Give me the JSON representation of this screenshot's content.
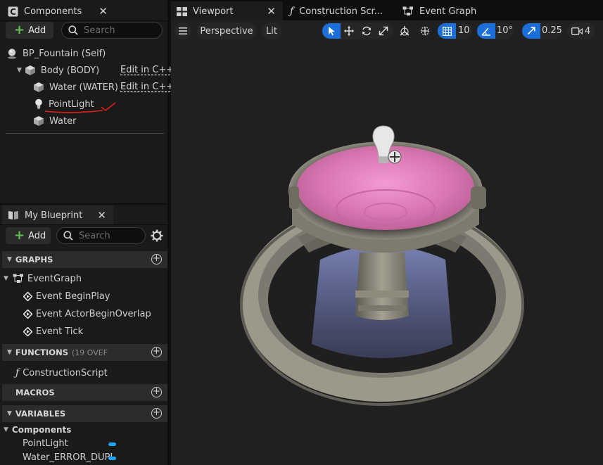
{
  "components_panel": {
    "tab_title": "Components",
    "add_label": "Add",
    "search_placeholder": "Search",
    "tree": {
      "root": "BP_Fountain (Self)",
      "body": "Body (BODY)",
      "water_child": "Water (WATER)",
      "pointlight": "PointLight",
      "water": "Water",
      "edit_cpp": "Edit in C++"
    }
  },
  "blueprint_panel": {
    "tab_title": "My Blueprint",
    "add_label": "Add",
    "search_placeholder": "Search",
    "graphs_header": "GRAPHS",
    "event_graph": "EventGraph",
    "events": [
      "Event BeginPlay",
      "Event ActorBeginOverlap",
      "Event Tick"
    ],
    "functions_header": "FUNCTIONS",
    "functions_note": "(19 OVEF",
    "construction_script": "ConstructionScript",
    "macros_header": "MACROS",
    "variables_header": "VARIABLES",
    "components_category": "Components",
    "variables": [
      "PointLight",
      "Water_ERROR_DUPL"
    ],
    "variable_color": "#1aa3ff"
  },
  "editor_tabs": {
    "viewport": "Viewport",
    "construction": "Construction Scr...",
    "event_graph": "Event Graph"
  },
  "viewport_toolbar": {
    "perspective": "Perspective",
    "lit": "Lit",
    "grid_snap": "10",
    "rotation_snap": "10°",
    "scale_snap": "0.25",
    "camera_speed": "4",
    "accent": "#1c6ed8"
  }
}
